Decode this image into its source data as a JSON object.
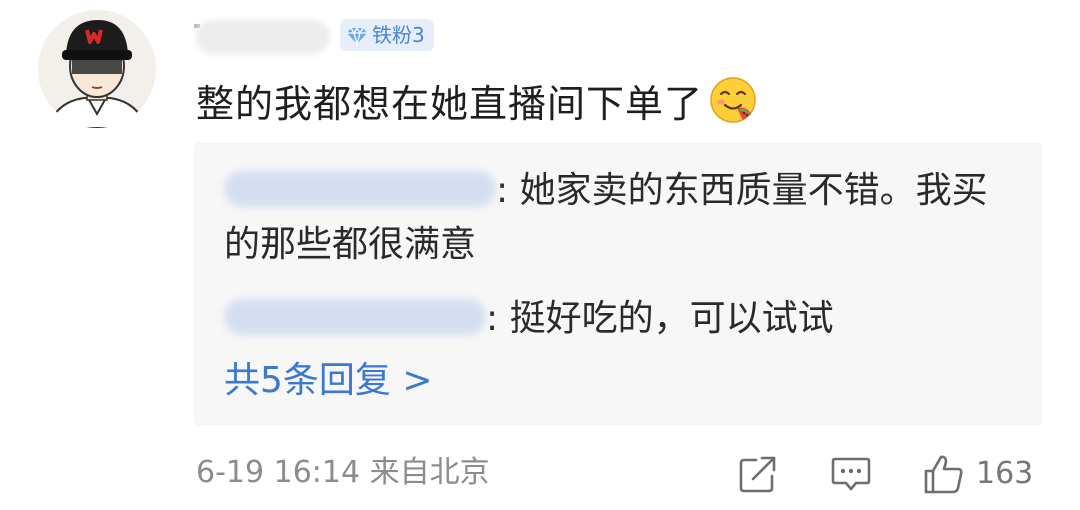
{
  "user": {
    "badge_label": "铁粉3",
    "badge_icon": "diamond-icon",
    "badge_color": "#4a84d6"
  },
  "comment": {
    "text": "整的我都想在她直播间下单了",
    "emoji": "yummy-face-emoji"
  },
  "replies": [
    {
      "separator": ":",
      "text": " 她家卖的东西质量不错。我买的那些都很满意"
    },
    {
      "separator": ":",
      "text": " 挺好吃的，可以试试"
    }
  ],
  "more_replies_label": "共5条回复 >",
  "footer": {
    "timestamp": "6-19 16:14",
    "location": "来自北京",
    "like_count": "163"
  },
  "colors": {
    "link": "#3a79cf",
    "meta_text": "#8c8c8c",
    "reply_box_bg": "#f7f7f7"
  }
}
